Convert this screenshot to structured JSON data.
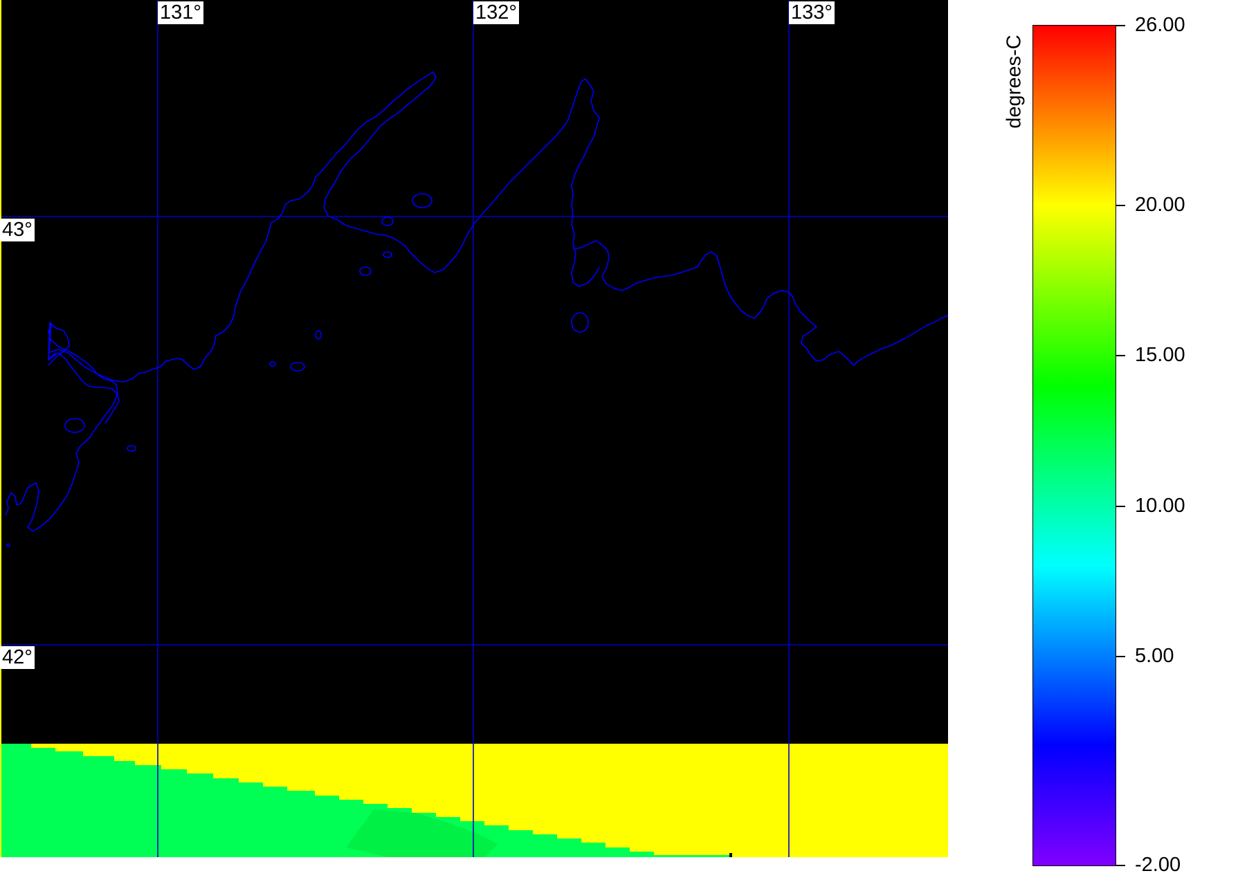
{
  "map": {
    "background_color": "#000000",
    "grid_color": "#0000cc",
    "coastline_color": "#0000ff",
    "longitude_labels": [
      "131°",
      "132°",
      "133°"
    ],
    "latitude_labels": [
      "43°",
      "42°"
    ],
    "fill_colors": {
      "land_mask": "#ffff00",
      "sea": "#00ff55",
      "sea_dark": "#00e63c"
    }
  },
  "colorbar": {
    "unit": "degrees-C",
    "tick_labels": [
      "26.00",
      "20.00",
      "15.00",
      "10.00",
      "5.00",
      "-2.00"
    ],
    "tick_values": [
      26,
      20,
      15,
      10,
      5,
      -2
    ],
    "range": [
      -2,
      26
    ],
    "gradient_stops": [
      {
        "value": -2,
        "color": "#8000ff"
      },
      {
        "value": 2,
        "color": "#0000ff"
      },
      {
        "value": 8,
        "color": "#00ffff"
      },
      {
        "value": 14,
        "color": "#00ff00"
      },
      {
        "value": 20,
        "color": "#ffff00"
      },
      {
        "value": 26,
        "color": "#ff0000"
      }
    ]
  }
}
